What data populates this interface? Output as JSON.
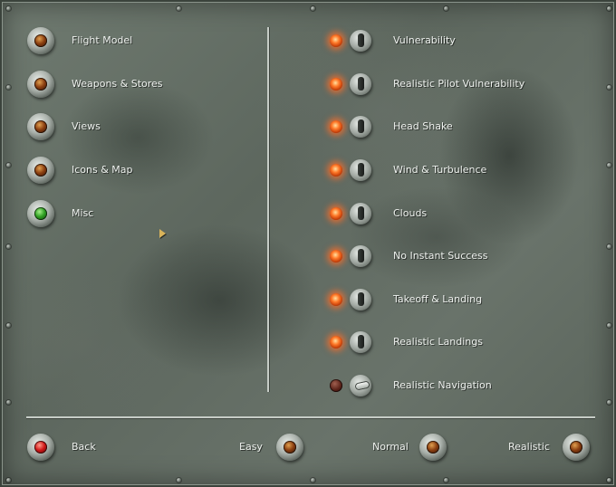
{
  "categories": [
    {
      "label": "Flight Model",
      "lens": "amber"
    },
    {
      "label": "Weapons & Stores",
      "lens": "amber"
    },
    {
      "label": "Views",
      "lens": "amber"
    },
    {
      "label": "Icons & Map",
      "lens": "amber"
    },
    {
      "label": "Misc",
      "lens": "green"
    }
  ],
  "options": [
    {
      "label": "Vulnerability",
      "enabled": true
    },
    {
      "label": "Realistic Pilot Vulnerability",
      "enabled": true
    },
    {
      "label": "Head Shake",
      "enabled": true
    },
    {
      "label": "Wind & Turbulence",
      "enabled": true
    },
    {
      "label": "Clouds",
      "enabled": true
    },
    {
      "label": "No Instant Success",
      "enabled": true
    },
    {
      "label": "Takeoff & Landing",
      "enabled": true
    },
    {
      "label": "Realistic Landings",
      "enabled": true
    },
    {
      "label": "Realistic Navigation",
      "enabled": false
    }
  ],
  "footer": {
    "back_label": "Back",
    "presets": [
      {
        "label": "Easy"
      },
      {
        "label": "Normal"
      },
      {
        "label": "Realistic"
      }
    ]
  },
  "colors": {
    "panel": "#65705f",
    "led_on": "#ff7a2a",
    "lens_selected": "#2fa022",
    "lens_back": "#d01818"
  }
}
